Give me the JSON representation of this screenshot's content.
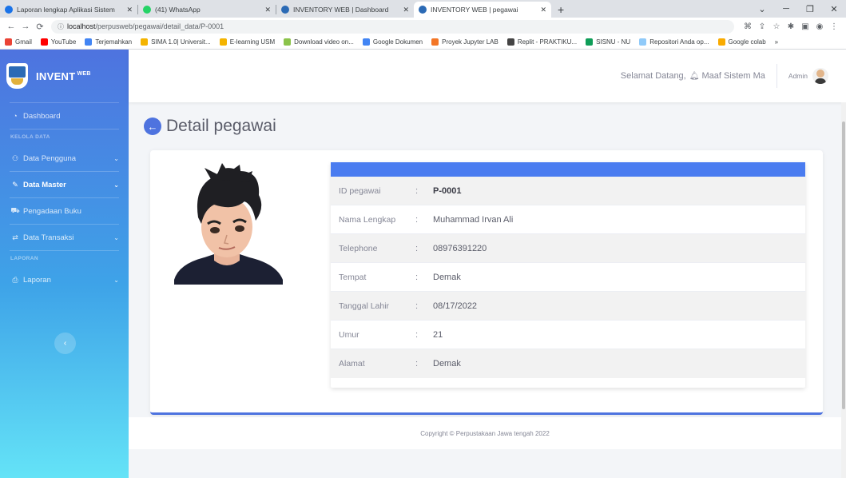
{
  "browser": {
    "tabs": [
      {
        "title": "Laporan lengkap Aplikasi Sistem",
        "color": "#1a73e8"
      },
      {
        "title": "(41) WhatsApp",
        "color": "#25d366"
      },
      {
        "title": "INVENTORY WEB | Dashboard",
        "color": "#2b6ab5"
      },
      {
        "title": "INVENTORY WEB | pegawai",
        "color": "#2b6ab5"
      }
    ],
    "url_host": "localhost",
    "url_path": "/perpusweb/pegawai/detail_data/P-0001",
    "bookmarks": [
      {
        "label": "Gmail",
        "color": "#ea4335"
      },
      {
        "label": "YouTube",
        "color": "#ff0000"
      },
      {
        "label": "Terjemahkan",
        "color": "#4285f4"
      },
      {
        "label": "SIMA 1.0| Universit...",
        "color": "#f4b400"
      },
      {
        "label": "E-learning USM",
        "color": "#f4b400"
      },
      {
        "label": "Download video on...",
        "color": "#8bc34a"
      },
      {
        "label": "Google Dokumen",
        "color": "#4285f4"
      },
      {
        "label": "Proyek Jupyter LAB",
        "color": "#f37626"
      },
      {
        "label": "Replit - PRAKTIKU...",
        "color": "#444444"
      },
      {
        "label": "SISNU - NU",
        "color": "#0f9d58"
      },
      {
        "label": "Repositori Anda op...",
        "color": "#90caf9"
      },
      {
        "label": "Google colab",
        "color": "#f9ab00"
      }
    ]
  },
  "sidebar": {
    "brand_main": "INVENT",
    "brand_sup": "WEB",
    "dashboard": "Dashboard",
    "heading_data": "KELOLA DATA",
    "data_pengguna": "Data Pengguna",
    "data_master": "Data Master",
    "pengadaan_buku": "Pengadaan Buku",
    "data_transaksi": "Data Transaksi",
    "heading_laporan": "LAPORAN",
    "laporan": "Laporan"
  },
  "topbar": {
    "welcome": "Selamat Datang,",
    "welcome_name": "Maaf Sistem Ma",
    "admin": "Admin"
  },
  "page": {
    "title": "Detail pegawai"
  },
  "details": {
    "rows": [
      {
        "label": "ID pegawai",
        "value": "P-0001"
      },
      {
        "label": "Nama Lengkap",
        "value": "Muhammad Irvan Ali"
      },
      {
        "label": "Telephone",
        "value": "08976391220"
      },
      {
        "label": "Tempat",
        "value": "Demak"
      },
      {
        "label": "Tanggal Lahir",
        "value": "08/17/2022"
      },
      {
        "label": "Umur",
        "value": "21"
      },
      {
        "label": "Alamat",
        "value": "Demak"
      }
    ]
  },
  "footer": {
    "copyright": "Copyright © Perpustakaan Jawa tengah 2022"
  },
  "colors": {
    "primary": "#4e73df",
    "table_header": "#4a7cf0"
  }
}
